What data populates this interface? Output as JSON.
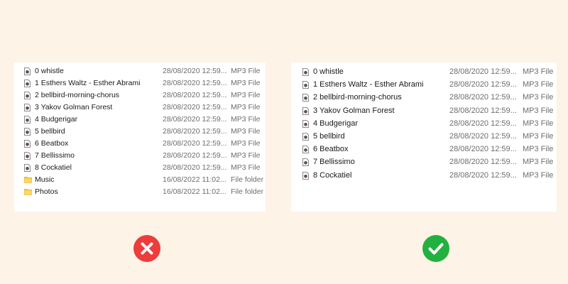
{
  "colors": {
    "background": "#fdf3e7",
    "wrong": "#ee3b3b",
    "right": "#22b03e"
  },
  "left_panel": {
    "verdict": "wrong",
    "verdict_icon": "x-icon",
    "rows": [
      {
        "name": "0 whistle",
        "date": "28/08/2020 12:59...",
        "type": "MP3 File",
        "icon": "audio-file-icon"
      },
      {
        "name": "1 Esthers Waltz - Esther Abrami",
        "date": "28/08/2020 12:59...",
        "type": "MP3 File",
        "icon": "audio-file-icon"
      },
      {
        "name": "2 bellbird-morning-chorus",
        "date": "28/08/2020 12:59...",
        "type": "MP3 File",
        "icon": "audio-file-icon"
      },
      {
        "name": "3 Yakov Golman Forest",
        "date": "28/08/2020 12:59...",
        "type": "MP3 File",
        "icon": "audio-file-icon"
      },
      {
        "name": "4 Budgerigar",
        "date": "28/08/2020 12:59...",
        "type": "MP3 File",
        "icon": "audio-file-icon"
      },
      {
        "name": "5 bellbird",
        "date": "28/08/2020 12:59...",
        "type": "MP3 File",
        "icon": "audio-file-icon"
      },
      {
        "name": "6 Beatbox",
        "date": "28/08/2020 12:59...",
        "type": "MP3 File",
        "icon": "audio-file-icon"
      },
      {
        "name": "7 Bellissimo",
        "date": "28/08/2020 12:59...",
        "type": "MP3 File",
        "icon": "audio-file-icon"
      },
      {
        "name": "8 Cockatiel",
        "date": "28/08/2020 12:59...",
        "type": "MP3 File",
        "icon": "audio-file-icon"
      },
      {
        "name": "Music",
        "date": "16/08/2022 11:02...",
        "type": "File folder",
        "icon": "folder-icon"
      },
      {
        "name": "Photos",
        "date": "16/08/2022 11:02...",
        "type": "File folder",
        "icon": "folder-icon"
      }
    ]
  },
  "right_panel": {
    "verdict": "right",
    "verdict_icon": "check-icon",
    "rows": [
      {
        "name": "0 whistle",
        "date": "28/08/2020 12:59...",
        "type": "MP3 File",
        "icon": "audio-file-icon"
      },
      {
        "name": "1 Esthers Waltz - Esther Abrami",
        "date": "28/08/2020 12:59...",
        "type": "MP3 File",
        "icon": "audio-file-icon"
      },
      {
        "name": "2 bellbird-morning-chorus",
        "date": "28/08/2020 12:59...",
        "type": "MP3 File",
        "icon": "audio-file-icon"
      },
      {
        "name": "3 Yakov Golman Forest",
        "date": "28/08/2020 12:59...",
        "type": "MP3 File",
        "icon": "audio-file-icon"
      },
      {
        "name": "4 Budgerigar",
        "date": "28/08/2020 12:59...",
        "type": "MP3 File",
        "icon": "audio-file-icon"
      },
      {
        "name": "5 bellbird",
        "date": "28/08/2020 12:59...",
        "type": "MP3 File",
        "icon": "audio-file-icon"
      },
      {
        "name": "6 Beatbox",
        "date": "28/08/2020 12:59...",
        "type": "MP3 File",
        "icon": "audio-file-icon"
      },
      {
        "name": "7 Bellissimo",
        "date": "28/08/2020 12:59...",
        "type": "MP3 File",
        "icon": "audio-file-icon"
      },
      {
        "name": "8 Cockatiel",
        "date": "28/08/2020 12:59...",
        "type": "MP3 File",
        "icon": "audio-file-icon"
      }
    ]
  }
}
